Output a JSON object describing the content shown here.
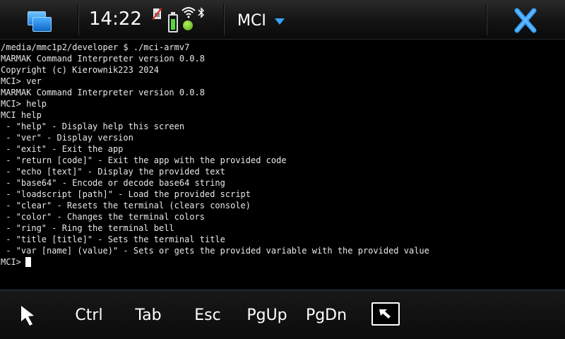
{
  "status_bar": {
    "time": "14:22",
    "app_title": "MCI",
    "battery_level": 0.7
  },
  "terminal": {
    "lines": [
      "/media/mmc1p2/developer $ ./mci-armv7",
      "MARMAK Command Interpreter version 0.0.8",
      "Copyright (c) Kierownik223 2024",
      "MCI> ver",
      "MARMAK Command Interpreter version 0.0.8",
      "MCI> help",
      "MCI help",
      " - \"help\" - Display help this screen",
      " - \"ver\" - Display version",
      " - \"exit\" - Exit the app",
      " - \"return [code]\" - Exit the app with the provided code",
      " - \"echo [text]\" - Display the provided text",
      " - \"base64\" - Encode or decode base64 string",
      " - \"loadscript [path]\" - Load the provided script",
      " - \"clear\" - Resets the terminal (clears console)",
      " - \"color\" - Changes the terminal colors",
      " - \"ring\" - Ring the terminal bell",
      " - \"title [title]\" - Sets the terminal title",
      " - \"var [name] (value)\" - Sets or gets the provided variable with the provided value"
    ],
    "prompt": "MCI>"
  },
  "keys": {
    "ctrl": "Ctrl",
    "tab": "Tab",
    "esc": "Esc",
    "pgup": "PgUp",
    "pgdn": "PgDn"
  },
  "colors": {
    "accent_blue": "#3aa2ff",
    "terminal_text": "#e8e8e8",
    "battery_green": "#54d83a"
  },
  "icons": {
    "task_switcher": "task-switcher-icon",
    "sim": "sim-icon",
    "battery": "battery-icon",
    "wifi": "wifi-icon",
    "presence": "presence-icon",
    "bluetooth": "bluetooth-icon",
    "menu": "chevron-down-icon",
    "close": "close-icon",
    "pointer": "cursor-arrow-icon",
    "keyboard_toggle": "keyboard-toggle-icon"
  }
}
